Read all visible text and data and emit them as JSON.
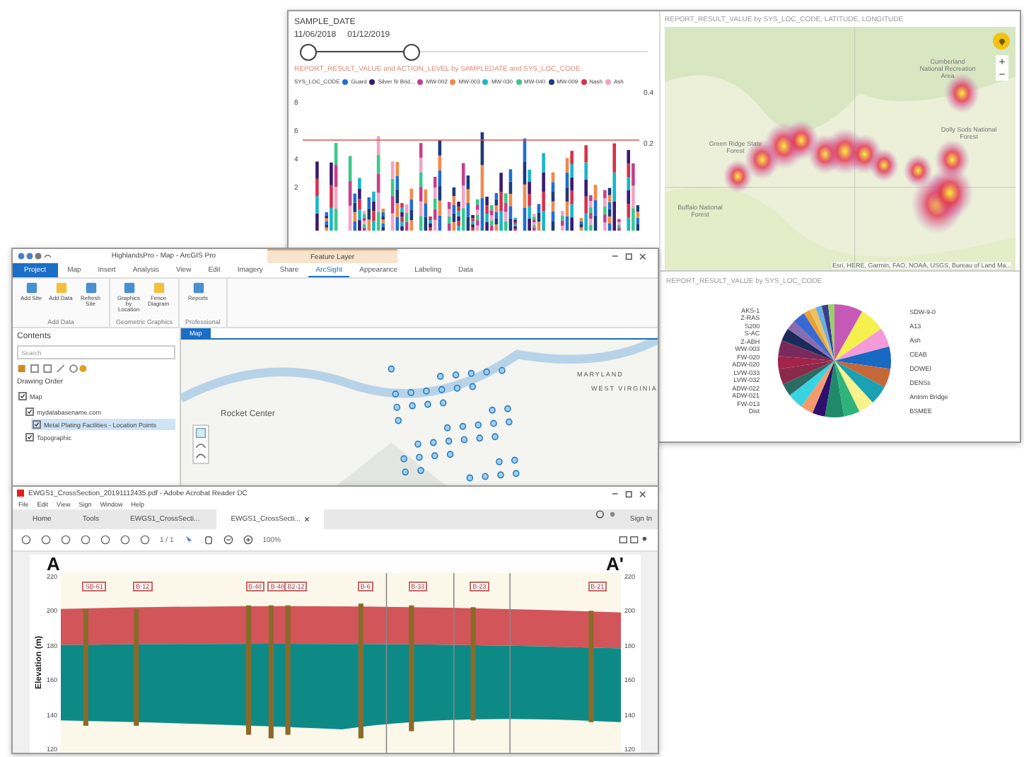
{
  "dashboard": {
    "slicer": {
      "title": "SAMPLE_DATE",
      "start": "11/06/2018",
      "end": "01/12/2019",
      "level": 0.32
    },
    "bar_chart": {
      "title": "REPORT_RESULT_VALUE and ACTION_LEVEL by SAMPLEDATE and SYS_LOC_CODE",
      "legend_title": "SYS_LOC_CODE",
      "legend": [
        {
          "label": "Guard",
          "color": "#1f6fd1"
        },
        {
          "label": "Silver fir Brid...",
          "color": "#3b1a6e"
        },
        {
          "label": "MW-002",
          "color": "#c4408c"
        },
        {
          "label": "MW-003",
          "color": "#f08a4b"
        },
        {
          "label": "MW-030",
          "color": "#17b6c9"
        },
        {
          "label": "MW-040",
          "color": "#39c98a"
        },
        {
          "label": "MW-009",
          "color": "#1a3a7a"
        },
        {
          "label": "Nash",
          "color": "#d9304a"
        },
        {
          "label": "Ash",
          "color": "#f2a3c7"
        }
      ],
      "left_ticks": [
        "8",
        "6",
        "4",
        "2"
      ],
      "right_ticks": [
        "0.4",
        "0.2"
      ]
    },
    "heat_map": {
      "title": "REPORT_RESULT_VALUE by SYS_LOC_CODE, LATITUDE, LONGITUDE",
      "places": [
        "Cumberland National Recreation Area",
        "Green Ridge State Forest",
        "Buffalo National Forest",
        "Dolly Sods National Forest"
      ],
      "attribution": "Esri, HERE, Garmin, FAO, NOAA, USGS, Bureau of Land Ma..."
    },
    "pie": {
      "title": "REPORT_RESULT_VALUE by SYS_LOC_CODE",
      "right_labels": [
        "SDW-9-0",
        "A13",
        "Ash",
        "CEAB",
        "DOWEI",
        "DENSs",
        "Antrim Bridge",
        "BSMEE"
      ],
      "left_labels": [
        "AKS-1",
        "Z-RAS",
        "S200",
        "S-AC",
        "Z-ABH",
        "WW-003",
        "FW-020",
        "ADW-020",
        "LVW-033",
        "LVW-032",
        "ADW-022",
        "ADW-021",
        "FW-013",
        "Dist"
      ]
    }
  },
  "arcgis": {
    "title": "HighlandsPro - Map - ArcGIS Pro",
    "context_tab": "Feature Layer",
    "tabs": [
      {
        "label": "Project",
        "selected": false,
        "kind": "file"
      },
      {
        "label": "Map",
        "selected": false,
        "kind": "tab"
      },
      {
        "label": "Insert",
        "selected": false,
        "kind": "tab"
      },
      {
        "label": "Analysis",
        "selected": false,
        "kind": "tab"
      },
      {
        "label": "View",
        "selected": false,
        "kind": "tab"
      },
      {
        "label": "Edit",
        "selected": false,
        "kind": "tab"
      },
      {
        "label": "Imagery",
        "selected": false,
        "kind": "tab"
      },
      {
        "label": "Share",
        "selected": false,
        "kind": "tab"
      },
      {
        "label": "ArcSight",
        "selected": true,
        "kind": "tab"
      },
      {
        "label": "Appearance",
        "selected": false,
        "kind": "tab"
      },
      {
        "label": "Labeling",
        "selected": false,
        "kind": "tab"
      },
      {
        "label": "Data",
        "selected": false,
        "kind": "tab"
      }
    ],
    "ribbon_groups": [
      {
        "label": "Add Data",
        "buttons": [
          "Add Site",
          "Add Data",
          "Refresh Site"
        ]
      },
      {
        "label": "Geometric Graphics",
        "buttons": [
          "Graphics by Location",
          "Fence Diagram"
        ]
      },
      {
        "label": "Professional",
        "buttons": [
          "Reports"
        ]
      }
    ],
    "contents": {
      "title": "Contents",
      "search_placeholder": "Search",
      "heading": "Drawing Order",
      "layers": [
        {
          "label": "Map",
          "checked": true,
          "children": [
            {
              "label": "mydatabasename.com",
              "checked": true,
              "children": [
                {
                  "label": "Metal Plating Facilities - Location Points",
                  "checked": true,
                  "selected": true
                }
              ]
            },
            {
              "label": "Topographic",
              "checked": true
            }
          ]
        }
      ]
    },
    "map_tab": "Map",
    "map_labels": [
      "Rocket Center",
      "MARYLAND",
      "WEST VIRGINIA"
    ]
  },
  "acrobat": {
    "title": "EWGS1_CrossSection_20191112435.pdf - Adobe Acrobat Reader DC",
    "menu": [
      "File",
      "Edit",
      "View",
      "Sign",
      "Window",
      "Help"
    ],
    "tabs": [
      {
        "label": "Home",
        "selected": false,
        "closable": false
      },
      {
        "label": "Tools",
        "selected": false,
        "closable": false
      },
      {
        "label": "EWGS1_CrossSecti...",
        "selected": false,
        "closable": false
      },
      {
        "label": "EWGS1_CrossSecti...",
        "selected": true,
        "closable": true
      }
    ],
    "sign_in": "Sign In",
    "page": "1 / 1",
    "zoom": "100%",
    "section": {
      "start": "A",
      "end": "A'",
      "axis_label": "Elevation (m)",
      "left_ticks": [
        "220",
        "200",
        "180",
        "160",
        "140",
        "120"
      ],
      "right_ticks": [
        "220",
        "200",
        "180",
        "160",
        "140",
        "120"
      ],
      "wells": [
        "SB-61",
        "B-12",
        "B-48",
        "B-48",
        "B2-12",
        "B-6",
        "B-33",
        "B-23",
        "B-21"
      ]
    }
  }
}
